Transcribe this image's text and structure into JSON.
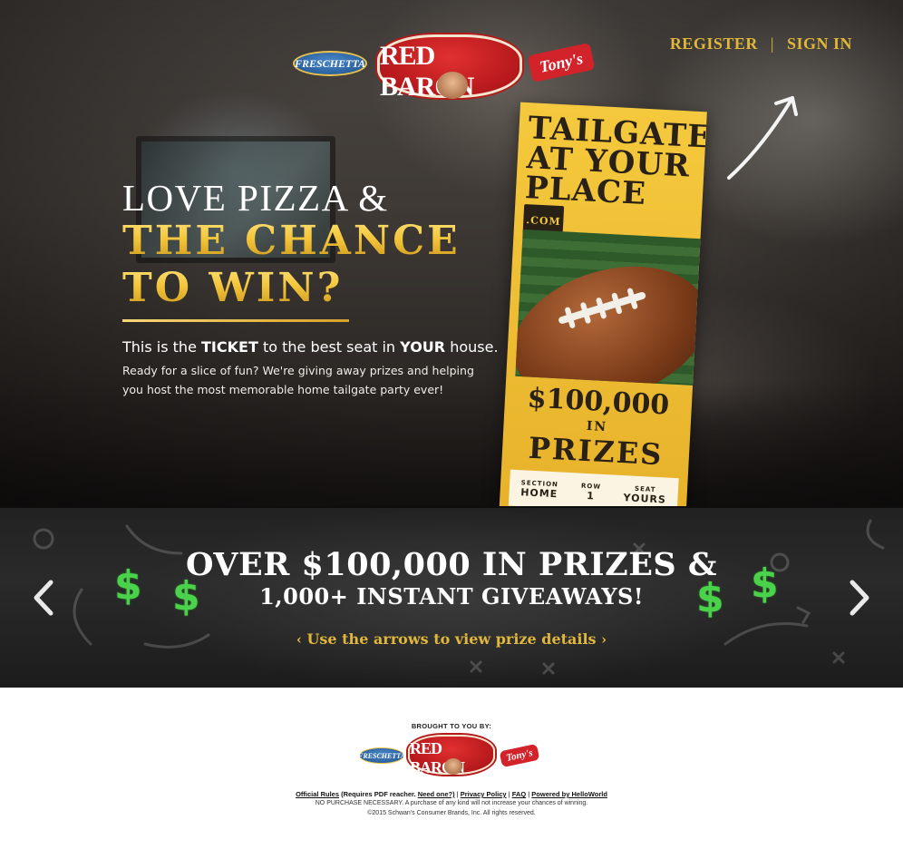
{
  "header": {
    "brands": [
      "FRESCHETTA",
      "RED BARON",
      "Tony's"
    ],
    "nav": {
      "register": "REGISTER",
      "separator": "|",
      "sign_in": "SIGN IN"
    }
  },
  "hero": {
    "headline_1": "LOVE PIZZA &",
    "headline_2": "THE CHANCE",
    "headline_3": "TO WIN?",
    "intro_pre": "This is the",
    "intro_ticket": "TICKET",
    "intro_mid": "to the best seat in",
    "intro_your": "YOUR",
    "intro_post": "house.",
    "body": "Ready for a slice of fun? We're giving away prizes and helping you host the most memorable home tailgate party ever!"
  },
  "ticket": {
    "title_1": "TAILGATE",
    "title_2": "AT YOUR",
    "title_3": "PLACE",
    "title_com": ".COM",
    "amount": "$100,000",
    "in": "IN",
    "prizes": "PRIZES",
    "seat": [
      {
        "key": "SECTION",
        "value": "HOME"
      },
      {
        "key": "ROW",
        "value": "1"
      },
      {
        "key": "SEAT",
        "value": "YOURS"
      }
    ]
  },
  "prize_band": {
    "title": "OVER $100,000 IN PRIZES &",
    "subtitle": "1,000+ INSTANT GIVEAWAYS!",
    "hint": "Use the arrows to view prize details",
    "dollar": "$",
    "colors": {
      "dollar": "#4bd24b",
      "hint": "#e0b73b"
    }
  },
  "footer": {
    "brought_by": "BROUGHT TO YOU BY:",
    "brands": [
      "FRESCHETTA",
      "RED BARON",
      "Tony's"
    ],
    "link_official_rules": "Official Rules",
    "note_pdf": "(Requires PDF reacher.",
    "link_need_one": "Need one?)",
    "link_privacy": "Privacy Policy",
    "link_faq": "FAQ",
    "link_powered": "Powered by HelloWorld",
    "separator": "|",
    "legal_1": "NO PURCHASE NECESSARY. A purchase of any kind will not increase your chances of winning.",
    "legal_2": "©2015 Schwan's Consumer Brands, Inc. All rights reserved."
  },
  "colors": {
    "gold": "#e0b73b",
    "ticket": "#f5c93d",
    "red_baron": "#c41a1f"
  }
}
